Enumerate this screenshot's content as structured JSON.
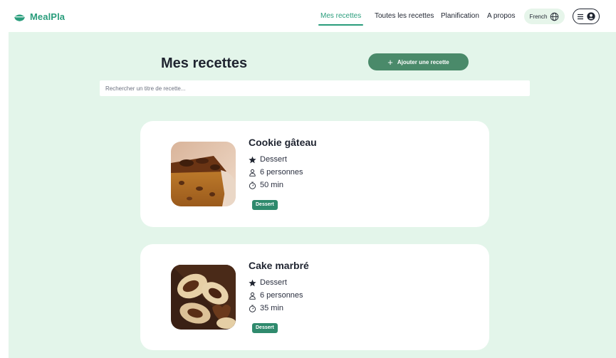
{
  "app": {
    "name": "MealPla"
  },
  "nav": {
    "items": [
      {
        "label": "Mes recettes",
        "active": true
      },
      {
        "label": "Toutes les recettes",
        "active": false
      },
      {
        "label": "Planification",
        "active": false
      },
      {
        "label": "A propos",
        "active": false
      }
    ],
    "language": "French"
  },
  "page": {
    "title": "Mes recettes",
    "add_button_label": "Ajouter une recette",
    "search": {
      "placeholder": "Rechercher un titre de recette...",
      "value": ""
    }
  },
  "recipes": [
    {
      "title": "Cookie gâteau",
      "category": "Dessert",
      "servings": "6 personnes",
      "duration": "50 min",
      "tag": "Dessert"
    },
    {
      "title": "Cake marbré",
      "category": "Dessert",
      "servings": "6 personnes",
      "duration": "35 min",
      "tag": "Dessert"
    }
  ],
  "icons": {
    "logo": "salad-bowl-icon",
    "language": "globe-icon",
    "menu": "hamburger-icon",
    "account": "user-circle-icon",
    "add": "plus-icon",
    "category": "star-icon",
    "servings": "person-icon",
    "duration": "timer-icon"
  },
  "colors": {
    "accent": "#2a9d7c",
    "background": "#e3f5ea",
    "primary_button": "#4a8a6a",
    "tag": "#2f8a6d"
  }
}
